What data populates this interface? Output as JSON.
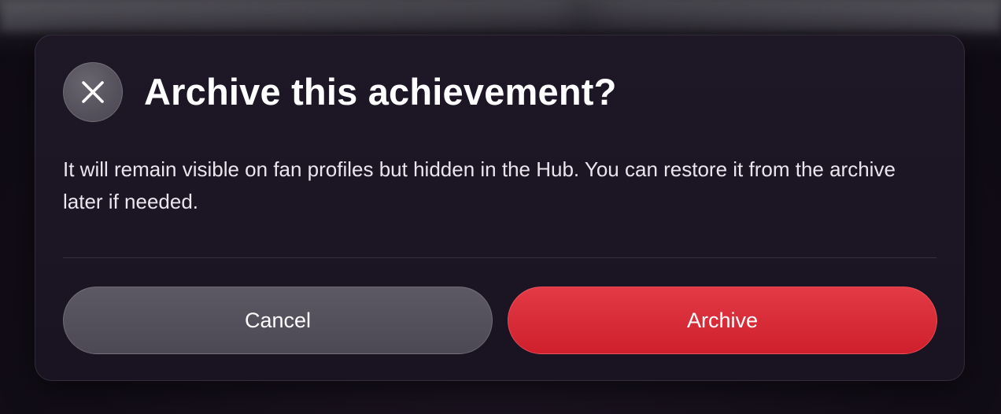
{
  "dialog": {
    "title": "Archive this achievement?",
    "message": "It will remain visible on fan profiles but hidden in the Hub. You can restore it from the archive later if needed.",
    "close_icon": "close-icon",
    "cancel_label": "Cancel",
    "confirm_label": "Archive"
  },
  "colors": {
    "dialog_background": "#1c1625",
    "cancel_button": "#545060",
    "confirm_button": "#d92a37",
    "text_primary": "#ffffff"
  }
}
